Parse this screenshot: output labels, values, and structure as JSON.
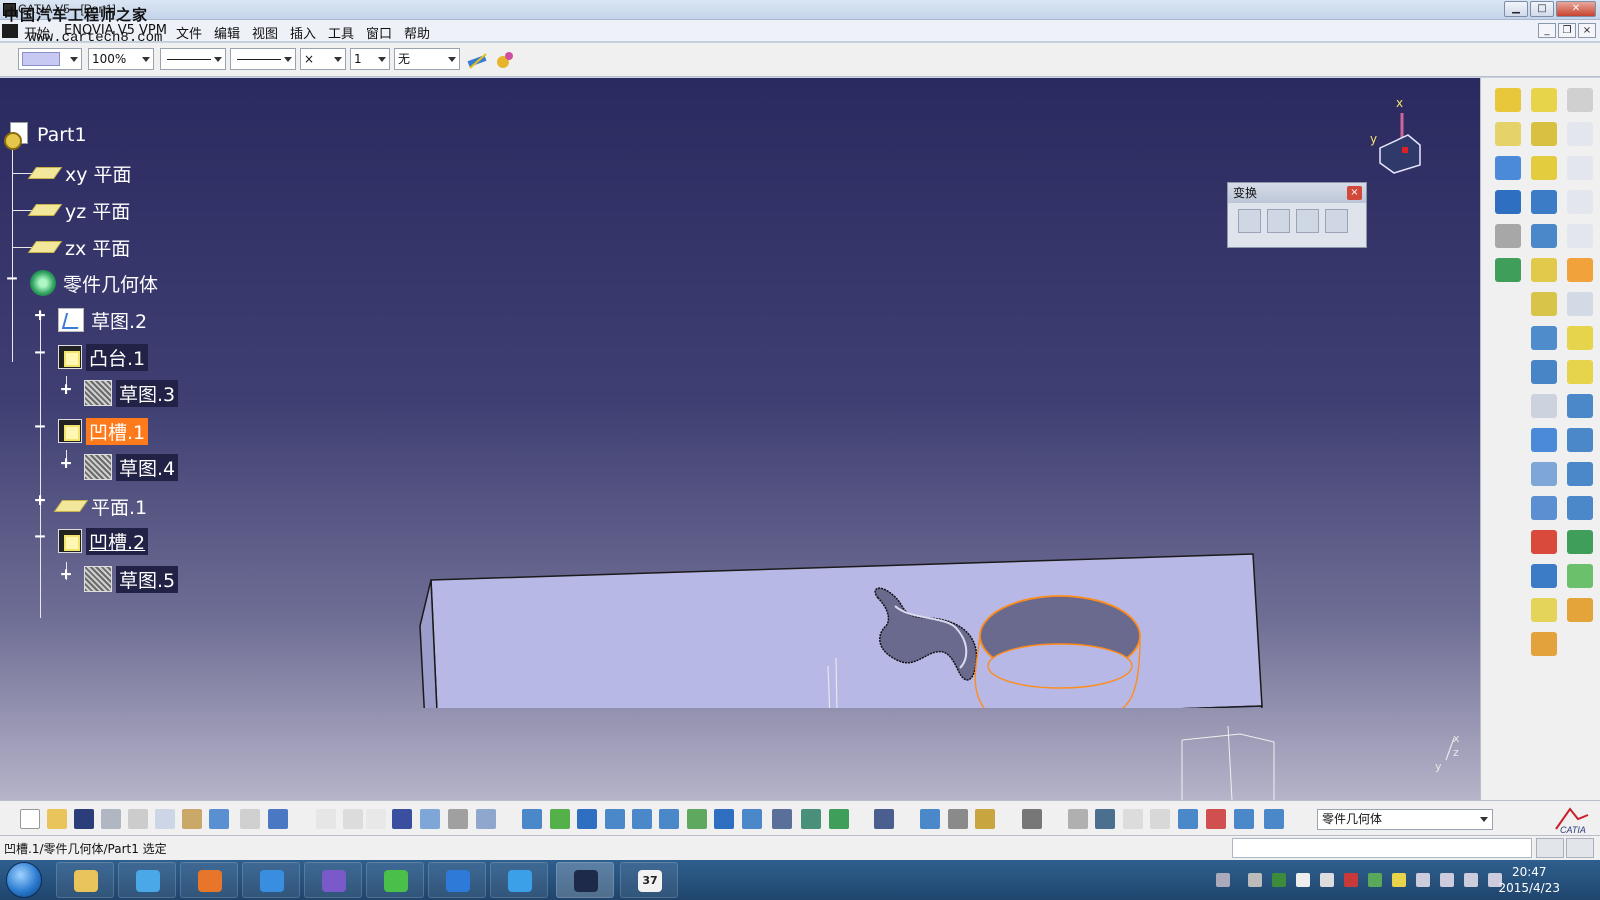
{
  "window": {
    "title": "CATIA V5 - [Part1]",
    "watermark": "中国汽车工程师之家",
    "watermark_url": "www.cartech8.com"
  },
  "menu": {
    "items": [
      "开始",
      "ENOVIA V5 VPM",
      "文件",
      "编辑",
      "视图",
      "插入",
      "工具",
      "窗口",
      "帮助"
    ]
  },
  "toolbar_top": {
    "zoom_value": "100%",
    "layer_value": "无",
    "point_style": "×",
    "number_value": "1"
  },
  "tree": {
    "root": "Part1",
    "nodes": [
      {
        "label": "xy 平面"
      },
      {
        "label": "yz 平面"
      },
      {
        "label": "zx 平面"
      },
      {
        "label": "零件几何体"
      },
      {
        "label": "草图.2"
      },
      {
        "label": "凸台.1"
      },
      {
        "label": "草图.3"
      },
      {
        "label": "凹槽.1"
      },
      {
        "label": "草图.4"
      },
      {
        "label": "平面.1"
      },
      {
        "label": "凹槽.2"
      },
      {
        "label": "草图.5"
      }
    ]
  },
  "transform_panel": {
    "title": "变换",
    "close": "×"
  },
  "compass": {
    "x_label": "x",
    "y_label": "y"
  },
  "axis": {
    "x": "x",
    "y": "y",
    "z": "z"
  },
  "bottom_toolbar": {
    "body_select": "零件几何体"
  },
  "status": {
    "text": "凹槽.1/零件几何体/Part1 选定"
  },
  "taskbar": {
    "time": "20:47",
    "date": "2015/4/23",
    "app_badge": "37"
  },
  "colors": {
    "viewport_top": "#2a2a60",
    "selection": "#ff7a1a",
    "part_face": "#b8b8e6",
    "hole_edge": "#ff8c1a"
  }
}
